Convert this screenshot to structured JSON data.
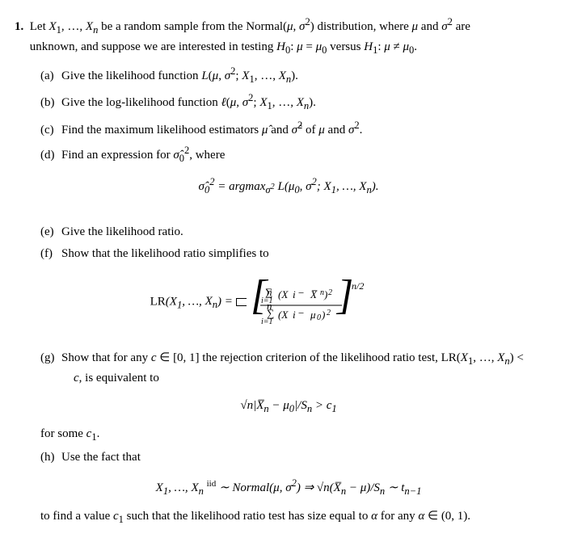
{
  "problem": {
    "number": "1.",
    "intro": "Let X₁, …, Xₙ be a random sample from the Normal(μ, σ²) distribution, where μ and σ² are unknown, and suppose we are interested in testing H₀: μ = μ₀ versus H₁: μ ≠ μ₀.",
    "parts": [
      {
        "label": "(a)",
        "text": "Give the likelihood function L(μ, σ²; X₁, …, Xₙ)."
      },
      {
        "label": "(b)",
        "text": "Give the log-likelihood function ℓ(μ, σ²; X₁, …, Xₙ)."
      },
      {
        "label": "(c)",
        "text": "Find the maximum likelihood estimators μ̂ and σ̂² of μ and σ²."
      },
      {
        "label": "(d)",
        "text": "Find an expression for σ̂₀², where"
      },
      {
        "label": "(e)",
        "text": "Give the likelihood ratio."
      },
      {
        "label": "(f)",
        "text": "Show that the likelihood ratio simplifies to"
      },
      {
        "label": "(g)",
        "text": "Show that for any c ∈ [0, 1] the rejection criterion of the likelihood ratio test, LR(X₁, …, Xₙ) < c, is equivalent to"
      },
      {
        "label": "(h)",
        "text": "Use the fact that"
      }
    ],
    "forsome": "for some c₁.",
    "tofind": "to find a value c₁ such that the likelihood ratio test has size equal to α for any α ∈ (0, 1)."
  }
}
